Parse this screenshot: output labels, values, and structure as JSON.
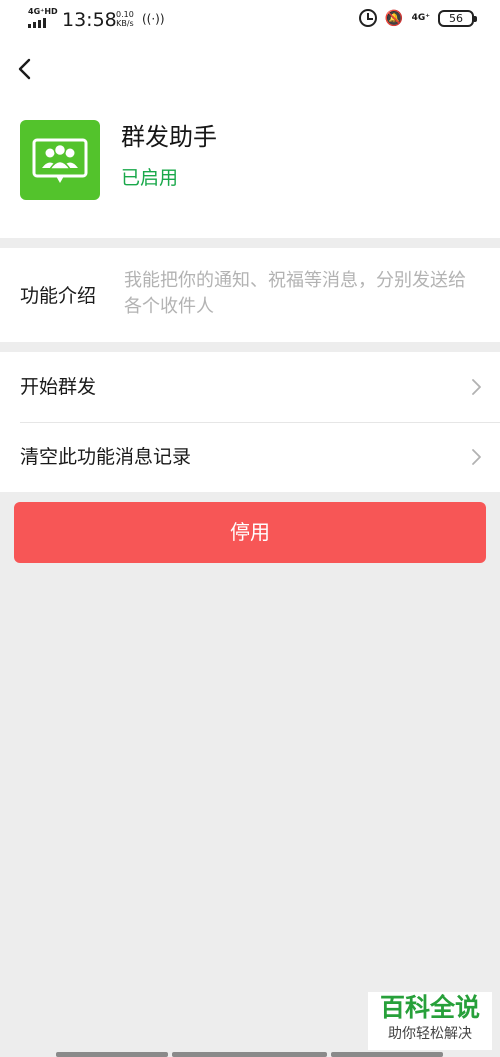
{
  "status_bar": {
    "network_type": "4G⁺HD",
    "time": "13:58",
    "speed_value": "0.10",
    "speed_unit": "KB/s",
    "secondary_network": "4G⁺",
    "battery": "56"
  },
  "header": {
    "back_icon": "chevron-left-icon",
    "app_icon": "group-chat-icon",
    "app_name": "群发助手",
    "app_status": "已启用"
  },
  "intro": {
    "label": "功能介绍",
    "text": "我能把你的通知、祝福等消息，分别发送给各个收件人"
  },
  "menu": {
    "items": [
      {
        "label": "开始群发"
      },
      {
        "label": "清空此功能消息记录"
      }
    ]
  },
  "actions": {
    "disable_label": "停用"
  },
  "watermark": {
    "title": "百科全说",
    "subtitle": "助你轻松解决"
  },
  "colors": {
    "accent_green": "#19a84a",
    "icon_green": "#53c32c",
    "danger_red": "#f75656",
    "page_background": "#ededed"
  }
}
